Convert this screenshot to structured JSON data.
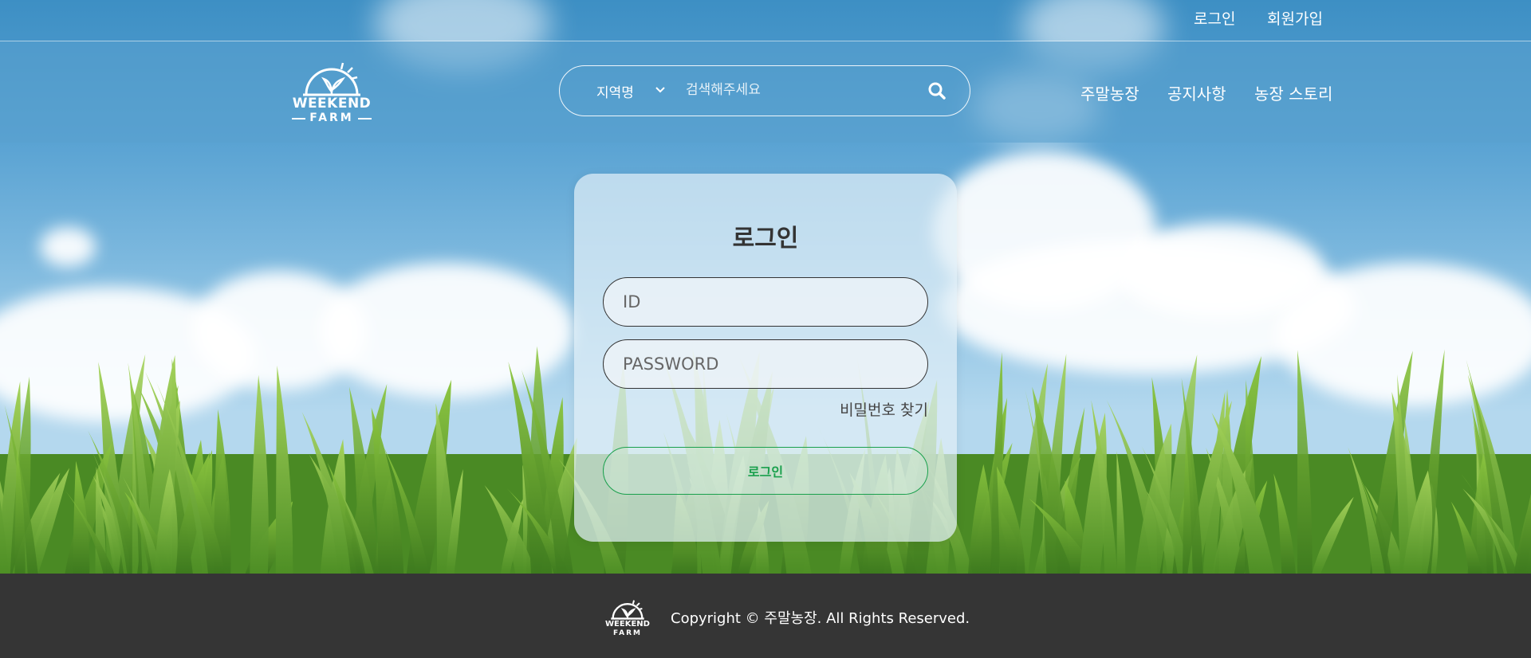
{
  "topbar": {
    "login": "로그인",
    "signup": "회원가입"
  },
  "logo": {
    "line1": "WEEKEND",
    "line2": "FARM"
  },
  "search": {
    "region_label": "지역명",
    "placeholder": "검색해주세요"
  },
  "nav": {
    "items": [
      "주말농장",
      "공지사항",
      "농장 스토리"
    ]
  },
  "login_card": {
    "title": "로그인",
    "id_placeholder": "ID",
    "password_placeholder": "PASSWORD",
    "forgot_password": "비밀번호 찾기",
    "submit_label": "로그인"
  },
  "footer": {
    "copyright": "Copyright © 주말농장. All Rights Reserved."
  },
  "colors": {
    "accent_green": "#1aa04d",
    "footer_bg": "#353535",
    "sky_blue": "#3d8fc4"
  },
  "icons": [
    "logo-sun-sprout-icon",
    "chevron-down-icon",
    "search-icon"
  ]
}
